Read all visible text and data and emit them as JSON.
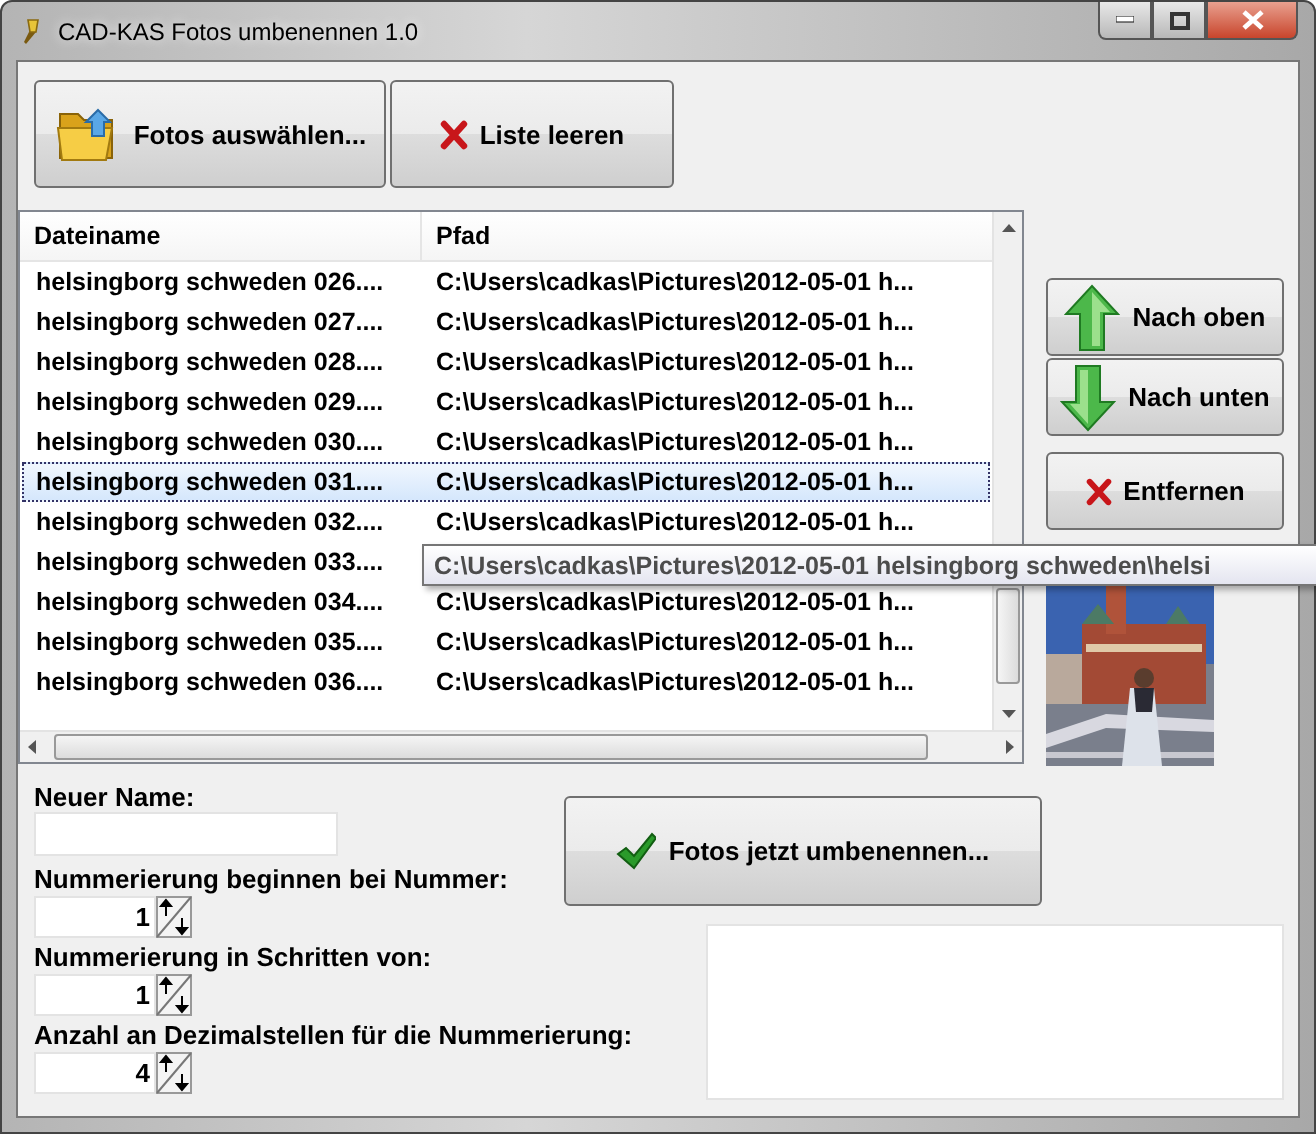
{
  "window": {
    "title": "CAD-KAS Fotos umbenennen 1.0"
  },
  "toolbar": [
    {
      "label": "Fotos auswählen...",
      "kind": "folder"
    },
    {
      "label": "Liste leeren",
      "kind": "clear"
    }
  ],
  "file_list": {
    "columns": [
      "Dateiname",
      "Pfad"
    ],
    "rows": [
      {
        "name": "helsingborg schweden 026....",
        "path": "C:\\Users\\cadkas\\Pictures\\2012-05-01 h...",
        "selected": false
      },
      {
        "name": "helsingborg schweden 027....",
        "path": "C:\\Users\\cadkas\\Pictures\\2012-05-01 h...",
        "selected": false
      },
      {
        "name": "helsingborg schweden 028....",
        "path": "C:\\Users\\cadkas\\Pictures\\2012-05-01 h...",
        "selected": false
      },
      {
        "name": "helsingborg schweden 029....",
        "path": "C:\\Users\\cadkas\\Pictures\\2012-05-01 h...",
        "selected": false
      },
      {
        "name": "helsingborg schweden 030....",
        "path": "C:\\Users\\cadkas\\Pictures\\2012-05-01 h...",
        "selected": false
      },
      {
        "name": "helsingborg schweden 031....",
        "path": "C:\\Users\\cadkas\\Pictures\\2012-05-01 h...",
        "selected": true
      },
      {
        "name": "helsingborg schweden 032....",
        "path": "C:\\Users\\cadkas\\Pictures\\2012-05-01 h...",
        "selected": false
      },
      {
        "name": "helsingborg schweden 033....",
        "selected": false
      },
      {
        "name": "helsingborg schweden 034....",
        "path": "C:\\Users\\cadkas\\Pictures\\2012-05-01 h...",
        "selected": false
      },
      {
        "name": "helsingborg schweden 035....",
        "path": "C:\\Users\\cadkas\\Pictures\\2012-05-01 h...",
        "selected": false
      },
      {
        "name": "helsingborg schweden 036....",
        "path": "C:\\Users\\cadkas\\Pictures\\2012-05-01 h...",
        "selected": false
      }
    ],
    "tooltip": "C:\\Users\\cadkas\\Pictures\\2012-05-01 helsingborg schweden\\helsi"
  },
  "side_buttons": [
    {
      "label": "Nach oben",
      "kind": "up"
    },
    {
      "label": "Nach unten",
      "kind": "down"
    },
    {
      "label": "Entfernen",
      "kind": "remove"
    }
  ],
  "form": {
    "new_name": {
      "label": "Neuer Name:"
    },
    "spinners": [
      {
        "label": "Nummerierung beginnen bei Nummer:",
        "value": "1"
      },
      {
        "label": "Nummerierung in Schritten von:",
        "value": "1"
      },
      {
        "label": "Anzahl an Dezimalstellen für die Nummerierung:",
        "value": "4"
      }
    ]
  },
  "rename_button": {
    "label": "Fotos jetzt umbenennen...",
    "kind": "check"
  }
}
